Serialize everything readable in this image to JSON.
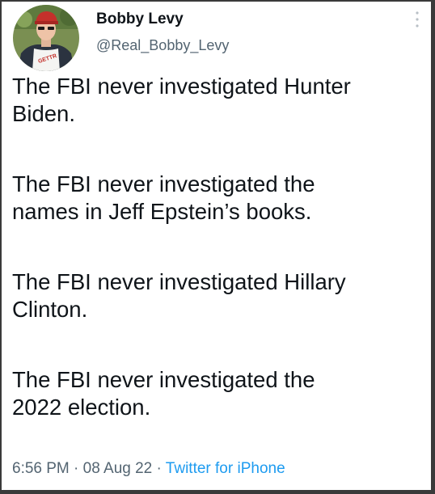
{
  "author": {
    "display_name": "Bobby Levy",
    "handle": "@Real_Bobby_Levy",
    "avatar_shirt_text": "GETTR"
  },
  "tweet": {
    "paragraphs": [
      "The FBI never investigated Hunter\nBiden.",
      "The FBI never investigated the\nnames in Jeff Epstein’s books.",
      "The FBI never investigated Hillary\nClinton.",
      "The FBI never investigated the\n2022 election."
    ],
    "time": "6:56 PM",
    "date": "08 Aug 22",
    "separator": " · ",
    "source": "Twitter for iPhone"
  },
  "colors": {
    "text": "#0f1419",
    "secondary": "#536471",
    "link": "#1d9bf0"
  },
  "icons": {
    "more": "more-vertical-icon"
  }
}
